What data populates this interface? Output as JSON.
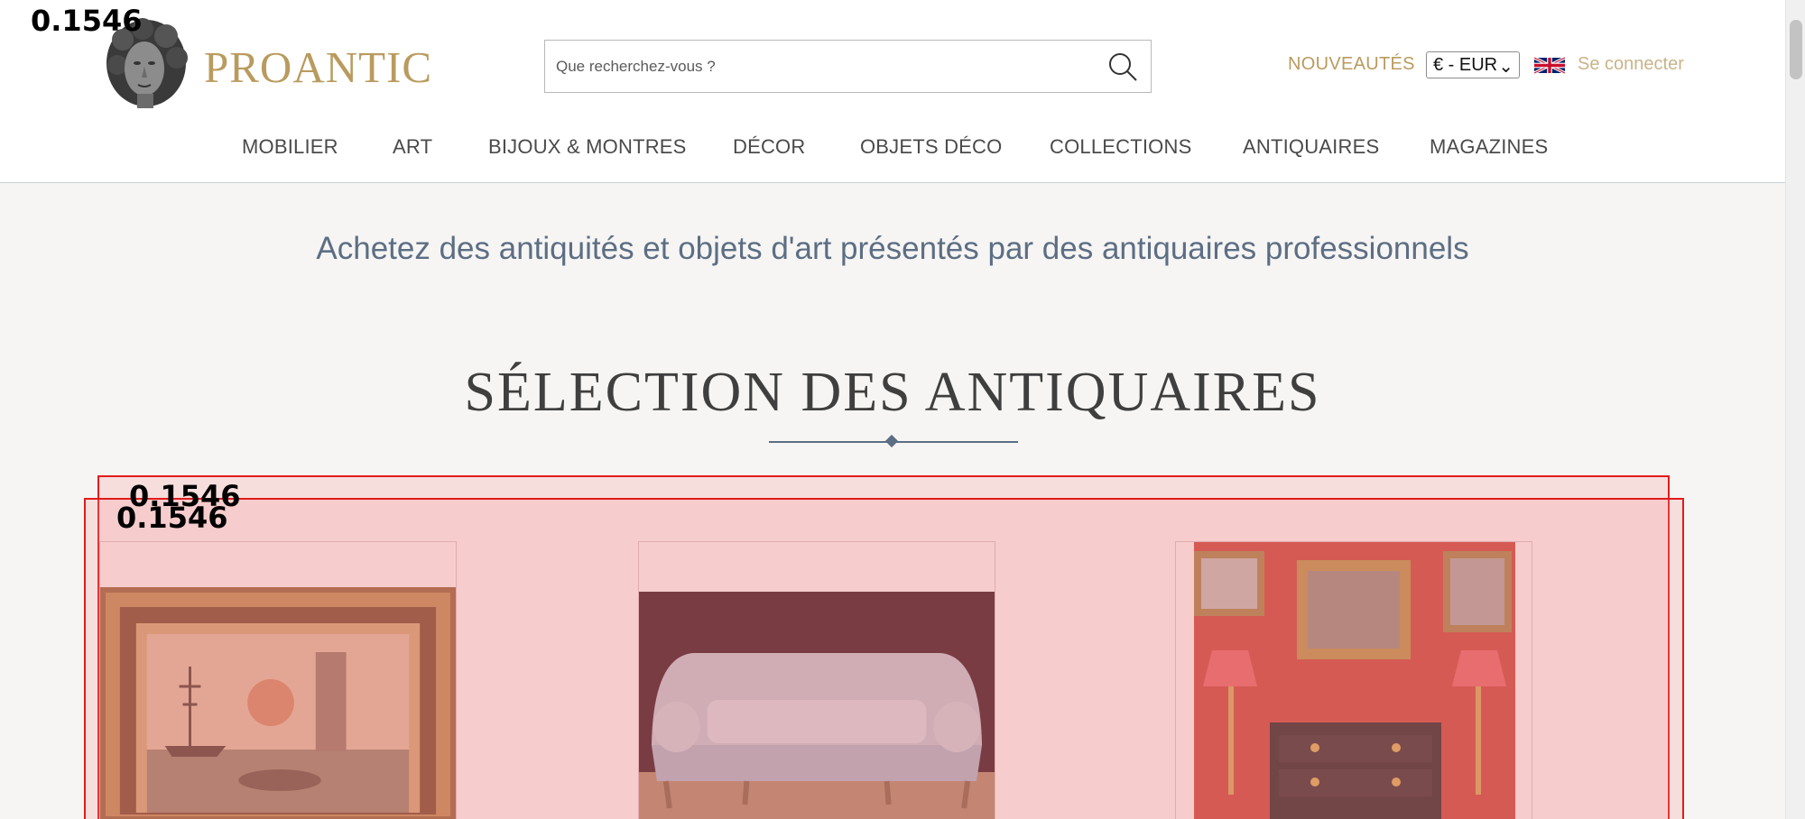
{
  "header": {
    "brand": "PROANTIC",
    "search_placeholder": "Que recherchez-vous ?",
    "nouveautes": "NOUVEAUTÉS",
    "currency": "€ - EUR",
    "login": "Se connecter",
    "colors": {
      "accent": "#b99b5e",
      "nav_text": "#4a4a4a",
      "tagline": "#5c6e84"
    }
  },
  "nav": {
    "items": [
      {
        "label": "MOBILIER"
      },
      {
        "label": "ART"
      },
      {
        "label": "BIJOUX & MONTRES"
      },
      {
        "label": "DÉCOR"
      },
      {
        "label": "OBJETS DÉCO"
      },
      {
        "label": "COLLECTIONS"
      },
      {
        "label": "ANTIQUAIRES"
      },
      {
        "label": "MAGAZINES"
      }
    ]
  },
  "main": {
    "tagline": "Achetez des antiquités et objets d'art présentés par des antiquaires professionnels",
    "section_title": "SÉLECTION DES ANTIQUAIRES",
    "cards": [
      {
        "image": "framed-seascape-painting"
      },
      {
        "image": "upholstered-sofa"
      },
      {
        "image": "antique-commode-red-room"
      }
    ]
  },
  "overlay": {
    "scores": [
      "0.1546",
      "0.1546",
      "0.1546"
    ]
  }
}
